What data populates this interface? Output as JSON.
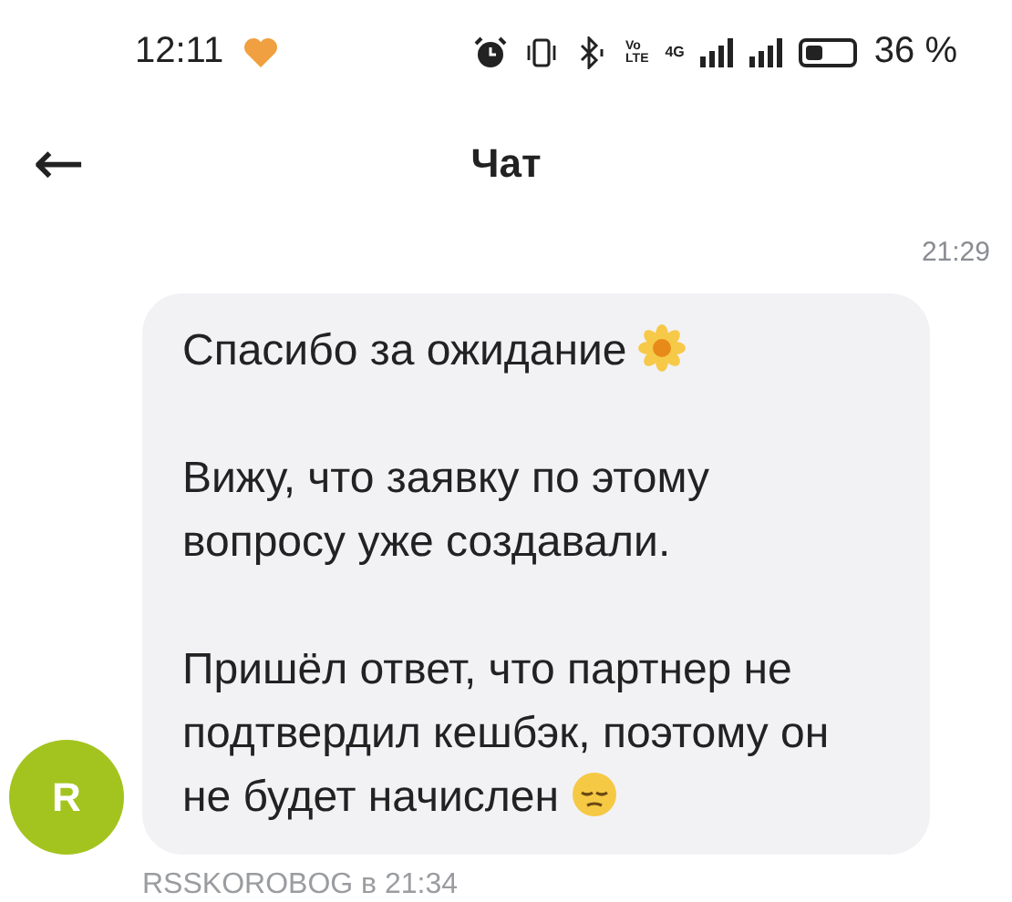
{
  "status_bar": {
    "time": "12:11",
    "volte_top": "Vo",
    "volte_bottom": "LTE",
    "network": "4G",
    "battery": "36 %"
  },
  "header": {
    "back": "←",
    "title": "Чат"
  },
  "message": {
    "time": "21:29",
    "paragraphs": [
      {
        "text": "Спасибо за ожидание",
        "kind": "flower"
      },
      {
        "text": "Вижу, что заявку по этому вопросу уже создавали.",
        "kind": "plain"
      },
      {
        "text": "Пришёл ответ, что партнер не подтвердил кешбэк, поэтому он не будет начислен",
        "kind": "pensive"
      }
    ],
    "avatar": {
      "letter": "R",
      "color": "#a3c41f"
    },
    "footer": "RSSKOROBOG в 21:34"
  }
}
